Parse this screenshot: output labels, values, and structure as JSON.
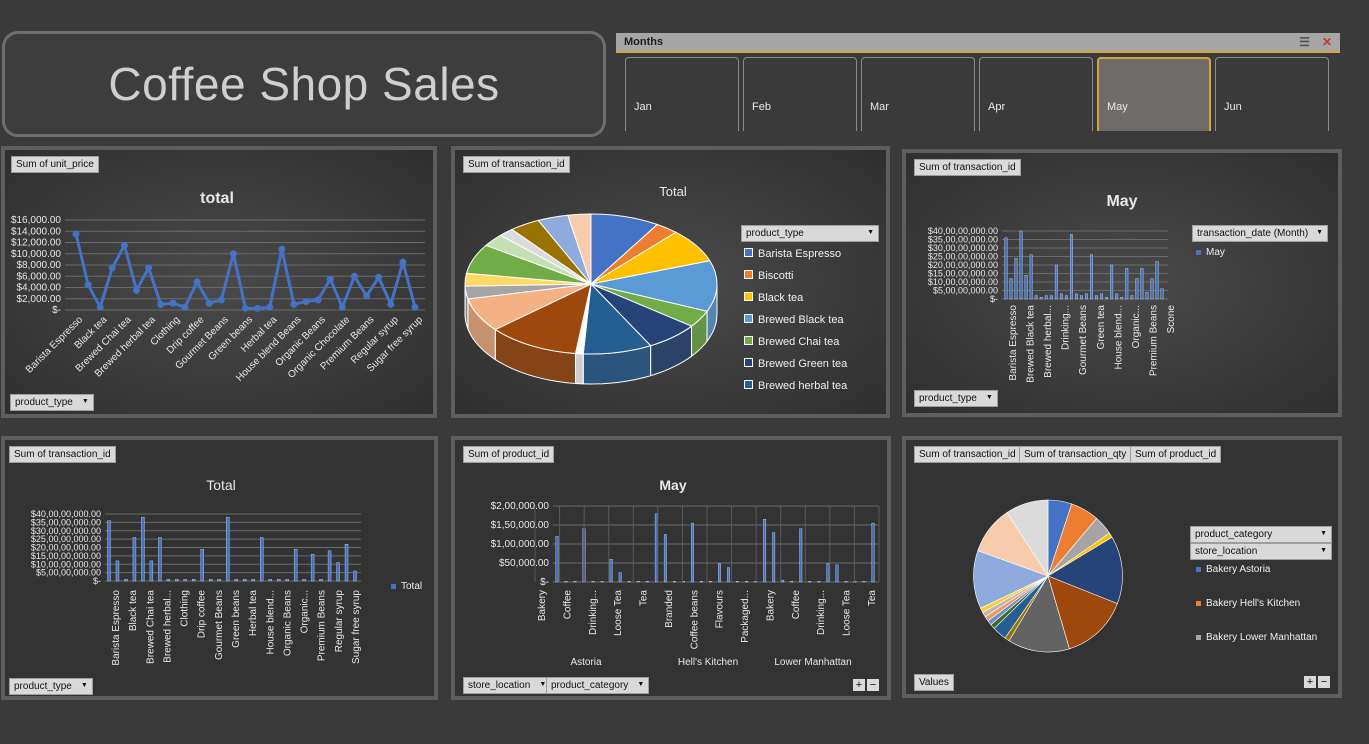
{
  "title": "Coffee Shop Sales",
  "slicer": {
    "header": "Months",
    "items": [
      "Jan",
      "Feb",
      "Mar",
      "Apr",
      "May",
      "Jun"
    ],
    "selected": "May",
    "multiselect_icon": "multi-select-icon",
    "clear_icon": "clear-filter-icon"
  },
  "colors": {
    "accent": "#4472c4",
    "border": "#5e5e5e",
    "highlight": "#d6a53a"
  },
  "panels": {
    "p1": {
      "field_tag": "Sum of unit_price",
      "filter_btn": "product_type"
    },
    "p2": {
      "field_tag": "Sum of transaction_id",
      "legend_field": "product_type"
    },
    "p3": {
      "field_tag": "Sum of transaction_id",
      "legend_field": "transaction_date  (Month)",
      "filter_btn": "product_type"
    },
    "p4": {
      "field_tag": "Sum of transaction_id",
      "filter_btn": "product_type"
    },
    "p5": {
      "field_tag": "Sum of product_id",
      "filter_btn1": "store_location",
      "filter_btn2": "product_category"
    },
    "p6": {
      "field_tags": [
        "Sum of transaction_id",
        "Sum of transaction_qty",
        "Sum of product_id"
      ],
      "legend_field1": "product_category",
      "legend_field2": "store_location",
      "values_btn": "Values"
    }
  },
  "chart_data": [
    {
      "type": "line",
      "title": "total",
      "categories": [
        "Barista Espresso",
        "Black tea",
        "Brewed Chai tea",
        "Brewed herbal tea",
        "Clothing",
        "Drip coffee",
        "Gourmet Beans",
        "Green beans",
        "Herbal tea",
        "House blend Beans",
        "Organic Beans",
        "Organic Chocolate",
        "Premium Beans",
        "Regular syrup",
        "Sugar free syrup"
      ],
      "values": [
        13500,
        4500,
        500,
        7500,
        11500,
        3500,
        7500,
        1000,
        1200,
        500,
        5000,
        1200,
        1800,
        10000,
        300,
        300,
        500,
        10800,
        1000,
        1500,
        1800,
        5500,
        500,
        6000,
        2500,
        5800,
        1000,
        8500,
        500
      ],
      "yticks": [
        "$16,000.00",
        "$14,000.00",
        "$12,000.00",
        "$10,000.00",
        "$8,000.00",
        "$6,000.00",
        "$4,000.00",
        "$2,000.00",
        "$-"
      ],
      "ylim": [
        0,
        16000
      ]
    },
    {
      "type": "pie",
      "title": "Total",
      "legend": [
        "Barista Espresso",
        "Biscotti",
        "Black tea",
        "Brewed Black tea",
        "Brewed Chai tea",
        "Brewed Green tea",
        "Brewed herbal tea"
      ],
      "slice_colors": [
        "#4472c4",
        "#ed7d31",
        "#ffc000",
        "#5b9bd5",
        "#70ad47",
        "#264478",
        "#255e91",
        "#ffffff",
        "#9e480e",
        "#f4b183",
        "#a5a5a5",
        "#ffd966",
        "#70ad47",
        "#c5e0b4",
        "#dbdbdb",
        "#997300",
        "#8faadc",
        "#f8cbad"
      ],
      "values": [
        9,
        3,
        8,
        12,
        4,
        7,
        9,
        1,
        12,
        8,
        3,
        3,
        7,
        3,
        2,
        4,
        4,
        3
      ]
    },
    {
      "type": "bar",
      "title": "May",
      "series_name": "May",
      "categories": [
        "Barista Espresso",
        "Brewed Black tea",
        "Brewed herbal...",
        "Drinking...",
        "Gourmet Beans",
        "Green tea",
        "House blend...",
        "Organic...",
        "Premium Beans",
        "Scone"
      ],
      "values": [
        36,
        12,
        24,
        40,
        14,
        26,
        2,
        1,
        2,
        2,
        20,
        3,
        2,
        38,
        3,
        2,
        3,
        26,
        2,
        3,
        1,
        20,
        3,
        1,
        18,
        2,
        12,
        18,
        4,
        12,
        22,
        6
      ],
      "yticks": [
        "$40,00,00,000.00",
        "$35,00,00,000.00",
        "$30,00,00,000.00",
        "$25,00,00,000.00",
        "$20,00,00,000.00",
        "$15,00,00,000.00",
        "$10,00,00,000.00",
        "$5,00,00,000.00",
        "$-"
      ],
      "ylim": [
        0,
        40
      ]
    },
    {
      "type": "bar",
      "title": "Total",
      "series_name": "Total",
      "categories": [
        "Barista Espresso",
        "Black tea",
        "Brewed Chai tea",
        "Brewed herbal...",
        "Clothing",
        "Drip coffee",
        "Gourmet Beans",
        "Green beans",
        "Herbal tea",
        "House blend...",
        "Organic Beans",
        "Organic...",
        "Premium Beans",
        "Regular syrup",
        "Sugar free syrup"
      ],
      "values": [
        36,
        12,
        1,
        26,
        38,
        12,
        26,
        1,
        1,
        1,
        1,
        19,
        1,
        1,
        38,
        1,
        1,
        1,
        26,
        1,
        1,
        1,
        19,
        1,
        16,
        1,
        18,
        11,
        22,
        6
      ],
      "yticks": [
        "$40,00,00,000.00",
        "$35,00,00,000.00",
        "$30,00,00,000.00",
        "$25,00,00,000.00",
        "$20,00,00,000.00",
        "$15,00,00,000.00",
        "$10,00,00,000.00",
        "$5,00,00,000.00",
        "$-"
      ],
      "ylim": [
        0,
        40
      ]
    },
    {
      "type": "bar",
      "title": "May",
      "groups": [
        "Astoria",
        "Hell's Kitchen",
        "Lower Manhattan"
      ],
      "categories": [
        "Bakery",
        "Coffee",
        "Drinking...",
        "Loose Tea",
        "Tea",
        "Branded",
        "Coffee beans",
        "Flavours",
        "Packaged...",
        "Bakery",
        "Coffee",
        "Drinking...",
        "Loose Tea",
        "Tea"
      ],
      "values": [
        120000,
        2000,
        2000,
        140000,
        2000,
        2000,
        60000,
        25000,
        2000,
        2000,
        2000,
        180000,
        125000,
        2000,
        2000,
        155000,
        2000,
        2000,
        48000,
        38000,
        2000,
        2000,
        2000,
        165000,
        130000,
        5000,
        2000,
        140000,
        2000,
        2000,
        48000,
        45000,
        2000,
        2000,
        2000,
        155000
      ],
      "yticks": [
        "$2,00,000.00",
        "$1,50,000.00",
        "$1,00,000.00",
        "$50,000.00",
        "$-"
      ],
      "ylim": [
        0,
        200000
      ]
    },
    {
      "type": "pie",
      "legend": [
        "Bakery Astoria",
        "Bakery Hell's Kitchen",
        "Bakery Lower Manhattan"
      ],
      "slice_colors": [
        "#4472c4",
        "#ed7d31",
        "#a5a5a5",
        "#ffc000",
        "#264478",
        "#9e480e",
        "#636363",
        "#997300",
        "#255e91",
        "#43682b",
        "#698ed0",
        "#f1975a",
        "#b7b7b7",
        "#ffcd33",
        "#8faadc",
        "#f8cbad",
        "#dbdbdb"
      ],
      "values": [
        5,
        6,
        4,
        1,
        14,
        14,
        13,
        1,
        3,
        1,
        1,
        1,
        1,
        1,
        12,
        10,
        9
      ]
    }
  ]
}
